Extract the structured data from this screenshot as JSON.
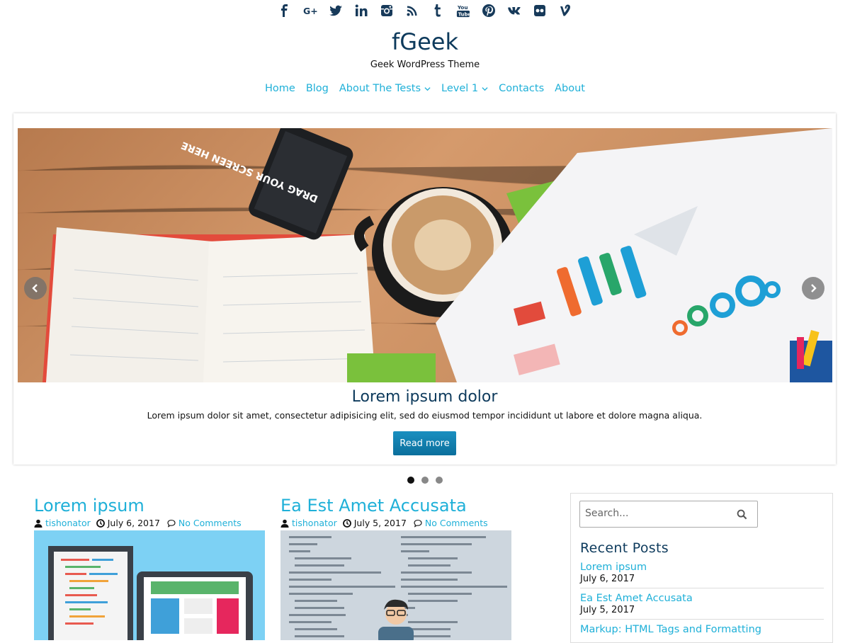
{
  "social": [
    {
      "icon": "facebook-icon"
    },
    {
      "icon": "google-plus-icon"
    },
    {
      "icon": "twitter-icon"
    },
    {
      "icon": "linkedin-icon"
    },
    {
      "icon": "instagram-icon"
    },
    {
      "icon": "rss-icon"
    },
    {
      "icon": "tumblr-icon"
    },
    {
      "icon": "youtube-icon"
    },
    {
      "icon": "pinterest-icon"
    },
    {
      "icon": "vk-icon"
    },
    {
      "icon": "flickr-icon"
    },
    {
      "icon": "vine-icon"
    }
  ],
  "site": {
    "title": "fGeek",
    "tagline": "Geek WordPress Theme"
  },
  "nav": [
    {
      "label": "Home"
    },
    {
      "label": "Blog"
    },
    {
      "label": "About The Tests",
      "dropdown": true
    },
    {
      "label": "Level 1",
      "dropdown": true
    },
    {
      "label": "Contacts"
    },
    {
      "label": "About"
    }
  ],
  "slider": {
    "image_text": "DRAG YOUR SCREEN HERE",
    "title": "Lorem ipsum dolor",
    "text": "Lorem ipsum dolor sit amet, consectetur adipisicing elit, sed do eiusmod tempor incididunt ut labore et dolore magna aliqua.",
    "button": "Read more",
    "active_dot": 1,
    "dot_count": 3
  },
  "posts": [
    {
      "title": "Lorem ipsum",
      "author": "tishonator",
      "date": "July 6, 2017",
      "comments": "No Comments"
    },
    {
      "title": "Ea Est Amet Accusata",
      "author": "tishonator",
      "date": "July 5, 2017",
      "comments": "No Comments"
    }
  ],
  "sidebar": {
    "search_placeholder": "Search...",
    "recent_title": "Recent Posts",
    "recent": [
      {
        "title": "Lorem ipsum",
        "date": "July 6, 2017"
      },
      {
        "title": "Ea Est Amet Accusata",
        "date": "July 5, 2017"
      },
      {
        "title": "Markup: HTML Tags and Formatting",
        "date": ""
      }
    ]
  },
  "colors": {
    "link": "#1fb0d8",
    "heading": "#0d3a5c",
    "button": "#0b7cb0"
  }
}
